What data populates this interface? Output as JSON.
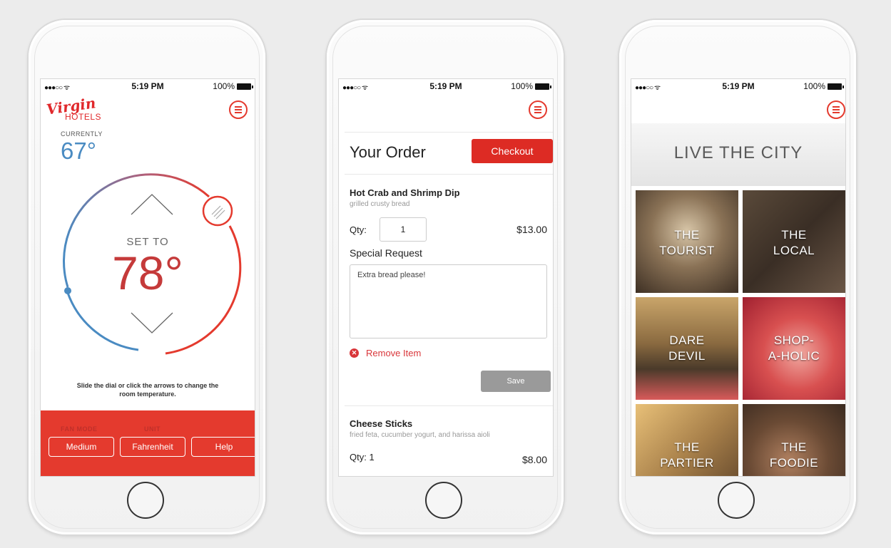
{
  "status": {
    "signal": "●●●○○ ᯤ",
    "time": "5:19 PM",
    "battery": "100%"
  },
  "thermostat": {
    "brand_script": "Virgin",
    "brand_word": "HOTELS",
    "currently_label": "CURRENTLY",
    "current_temp": "67°",
    "set_to_label": "SET TO",
    "set_temp": "78°",
    "hint": "Slide the dial or click the arrows to change the room temperature.",
    "fan_mode_label": "FAN MODE",
    "unit_label": "UNIT",
    "fan_mode_value": "Medium",
    "unit_value": "Fahrenheit",
    "help_label": "Help",
    "colors": {
      "cool": "#4a8bc2",
      "warm": "#e43a2e"
    }
  },
  "order": {
    "title": "Your Order",
    "checkout_label": "Checkout",
    "items": [
      {
        "name": "Hot Crab and Shrimp Dip",
        "description": "grilled crusty bread",
        "qty_label": "Qty:",
        "qty": "1",
        "price": "$13.00",
        "special_request_label": "Special Request",
        "special_request": "Extra bread please!",
        "remove_label": "Remove Item",
        "save_label": "Save"
      },
      {
        "name": "Cheese Sticks",
        "description": "fried feta, cucumber yogurt, and harissa aioli",
        "qty_text": "Qty: 1",
        "price": "$8.00"
      }
    ]
  },
  "city": {
    "title": "LIVE THE CITY",
    "tiles": [
      {
        "line1": "THE",
        "line2": "TOURIST"
      },
      {
        "line1": "THE",
        "line2": "LOCAL"
      },
      {
        "line1": "DARE",
        "line2": "DEVIL"
      },
      {
        "line1": "SHOP-",
        "line2": "A-HOLIC"
      },
      {
        "line1": "THE",
        "line2": "PARTIER"
      },
      {
        "line1": "THE",
        "line2": "FOODIE"
      }
    ]
  }
}
